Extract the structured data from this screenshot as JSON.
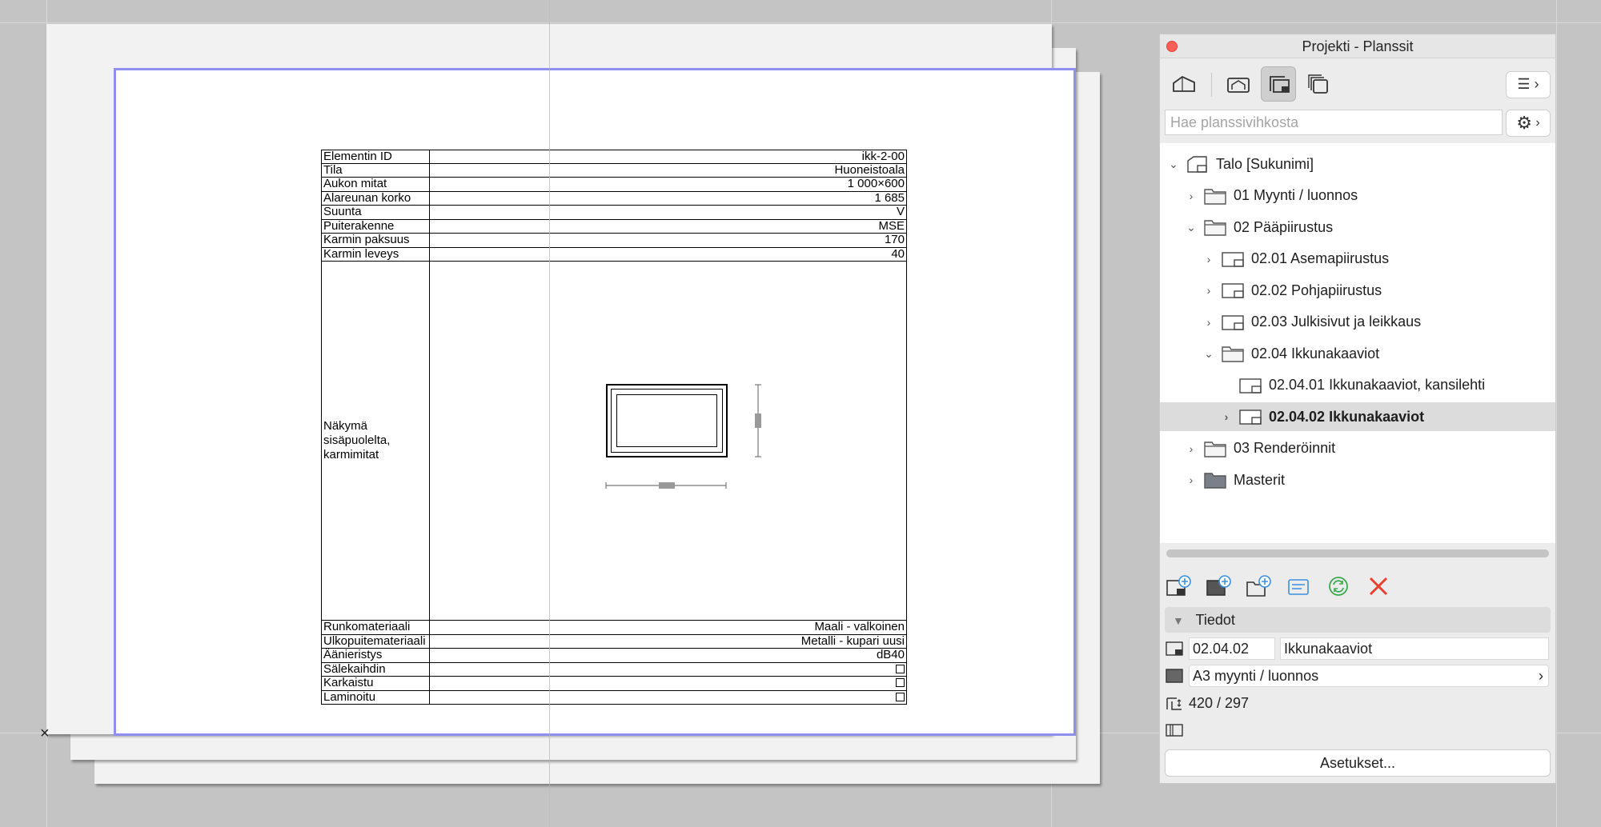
{
  "panel": {
    "title": "Projekti - Planssit",
    "search_placeholder": "Hae planssivihkosta",
    "tree": [
      {
        "label": "Talo [Sukunimi]",
        "chevron": "⌄",
        "icon": "project-book-icon",
        "selected": false
      },
      {
        "label": "01 Myynti / luonnos",
        "chevron": "›",
        "icon": "folder-icon",
        "selected": false
      },
      {
        "label": "02 Pääpiirustus",
        "chevron": "⌄",
        "icon": "folder-icon",
        "selected": false
      },
      {
        "label": "02.01 Asemapiirustus",
        "chevron": "›",
        "icon": "layout-sheet-icon",
        "selected": false
      },
      {
        "label": "02.02 Pohjapiirustus",
        "chevron": "›",
        "icon": "layout-sheet-icon",
        "selected": false
      },
      {
        "label": "02.03 Julkisivut ja leikkaus",
        "chevron": "›",
        "icon": "layout-sheet-icon",
        "selected": false
      },
      {
        "label": "02.04 Ikkunakaaviot",
        "chevron": "⌄",
        "icon": "folder-icon",
        "selected": false
      },
      {
        "label": "02.04.01 Ikkunakaaviot, kansilehti",
        "chevron": "",
        "icon": "layout-sheet-icon",
        "selected": false
      },
      {
        "label": "02.04.02 Ikkunakaaviot",
        "chevron": "›",
        "icon": "layout-sheet-icon",
        "selected": true
      },
      {
        "label": "03 Renderöinnit",
        "chevron": "›",
        "icon": "folder-icon",
        "selected": false
      },
      {
        "label": "Masterit",
        "chevron": "›",
        "icon": "master-folder-icon",
        "selected": false
      }
    ],
    "info_header": "Tiedot",
    "info_id": "02.04.02",
    "info_name": "Ikkunakaaviot",
    "info_master": "A3 myynti / luonnos",
    "info_size": "420 / 297",
    "settings_label": "Asetukset..."
  },
  "schedule": {
    "rows": [
      {
        "label": "Elementin ID",
        "value": "ikk-2-00"
      },
      {
        "label": "Tila",
        "value": "Huoneistoala"
      },
      {
        "label": "Aukon mitat",
        "value": "1 000×600"
      },
      {
        "label": "Alareunan korko",
        "value": "1 685"
      },
      {
        "label": "Suunta",
        "value": "V"
      },
      {
        "label": "Puiterakenne",
        "value": "MSE"
      },
      {
        "label": "Karmin paksuus",
        "value": "170"
      },
      {
        "label": "Karmin leveys",
        "value": "40"
      }
    ],
    "view_label": "Näkymä sisäpuolelta, karmimitat",
    "rows_bottom": [
      {
        "label": "Runkomateriaali",
        "value": "Maali - valkoinen"
      },
      {
        "label": "Ulkopuitemateriaali",
        "value": "Metalli - kupari uusi"
      },
      {
        "label": "Äänieristys",
        "value": "dB40"
      }
    ],
    "checkbox_rows": [
      {
        "label": "Sälekaihdin",
        "checked": false
      },
      {
        "label": "Karkaistu",
        "checked": false
      },
      {
        "label": "Laminoitu",
        "checked": false
      }
    ]
  },
  "colors": {
    "frame": "#8f8ff2",
    "background": "#c4c4c4",
    "selected_row": "#dcdcdc",
    "delete": "#e8402f",
    "refresh": "#3aa84a",
    "add_icon": "#3b8fe0"
  },
  "canvas": {
    "origin_marker": "×"
  }
}
